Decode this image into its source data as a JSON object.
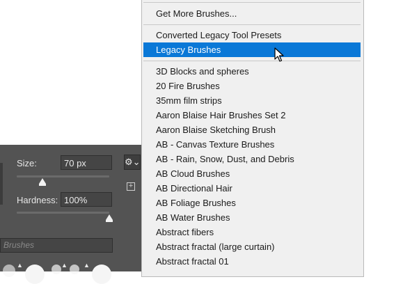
{
  "brush_panel": {
    "size_label": "Size:",
    "size_value": "70 px",
    "hardness_label": "Hardness:",
    "hardness_value": "100%",
    "search_placeholder": "Brushes",
    "size_level": 0.28,
    "hardness_level": 1.0,
    "gear_icon": "gear-icon",
    "new_brush_icon": "plus-box-icon"
  },
  "menu": {
    "items_top": [
      {
        "label": "Get More Brushes..."
      }
    ],
    "items_mid": [
      {
        "label": "Converted Legacy Tool Presets"
      },
      {
        "label": "Legacy Brushes",
        "selected": true
      }
    ],
    "items_list": [
      {
        "label": "3D Blocks and spheres"
      },
      {
        "label": "20 Fire Brushes"
      },
      {
        "label": "35mm film strips"
      },
      {
        "label": "Aaron Blaise Hair Brushes Set 2"
      },
      {
        "label": "Aaron Blaise Sketching Brush"
      },
      {
        "label": "AB - Canvas Texture Brushes"
      },
      {
        "label": "AB - Rain, Snow, Dust, and Debris"
      },
      {
        "label": "AB Cloud Brushes"
      },
      {
        "label": "AB Directional Hair"
      },
      {
        "label": "AB Foliage Brushes"
      },
      {
        "label": "AB Water Brushes"
      },
      {
        "label": "Abstract fibers"
      },
      {
        "label": "Abstract fractal (large curtain)"
      },
      {
        "label": "Abstract fractal 01"
      }
    ],
    "selected_color": "#0a78d7"
  }
}
